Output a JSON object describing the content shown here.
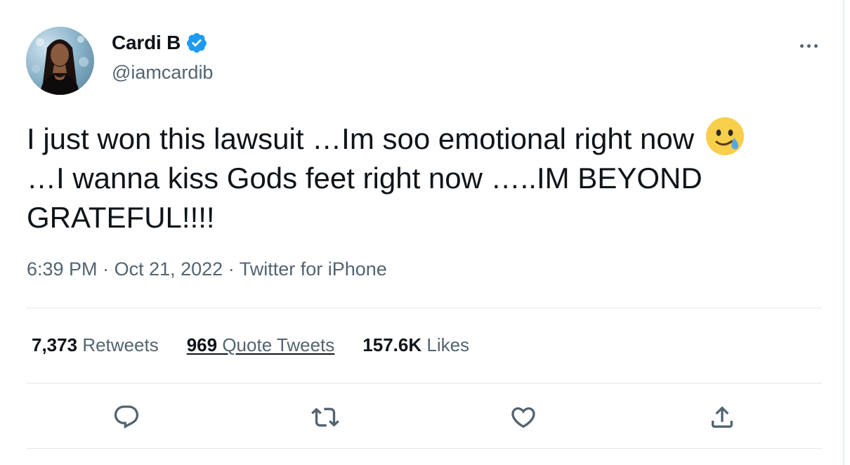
{
  "author": {
    "display_name": "Cardi B",
    "handle": "@iamcardib",
    "verified": true,
    "verified_color": "#1d9bf0"
  },
  "tweet": {
    "text": "I just won this lawsuit …Im soo emotional right now",
    "text_line2": "…I wanna kiss Gods feet right now …..IM BEYOND GRATEFUL!!!!",
    "emoji": "face-holding-back-tears"
  },
  "meta": {
    "time": "6:39 PM",
    "separator": "·",
    "date": "Oct 21, 2022",
    "source": "Twitter for iPhone"
  },
  "stats": {
    "retweets_count": "7,373",
    "retweets_label": "Retweets",
    "quotes_count": "969",
    "quotes_label": "Quote Tweets",
    "likes_count": "157.6K",
    "likes_label": "Likes"
  },
  "actions": {
    "reply_icon": "reply-icon",
    "retweet_icon": "retweet-icon",
    "like_icon": "heart-icon",
    "share_icon": "share-icon"
  },
  "colors": {
    "text_primary": "#0f1419",
    "text_secondary": "#536471",
    "divider": "#e1e8ed"
  }
}
